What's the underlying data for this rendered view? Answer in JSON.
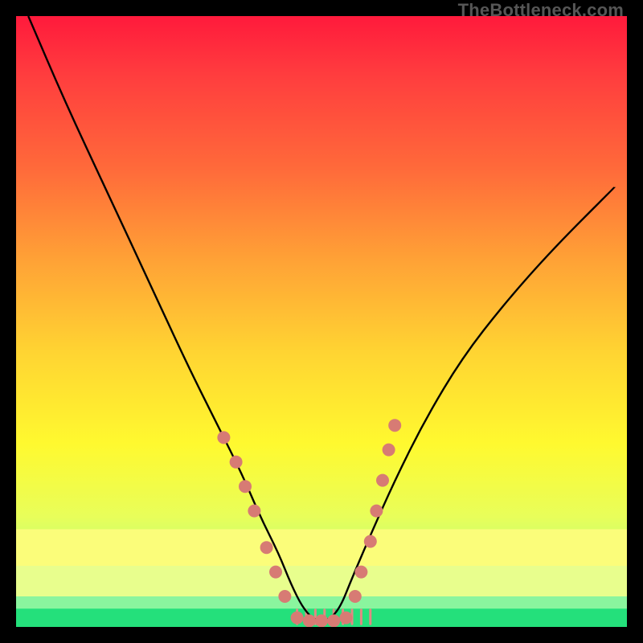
{
  "watermark": "TheBottleneck.com",
  "chart_data": {
    "type": "line",
    "title": "",
    "xlabel": "",
    "ylabel": "",
    "xlim": [
      0,
      100
    ],
    "ylim": [
      0,
      100
    ],
    "grid": false,
    "legend": false,
    "curve_note": "V-shaped curve representing bottleneck percentage; minimum at center, sharply rising to both sides. Y axis is inverted visually (high value plotted near top).",
    "series": [
      {
        "name": "bottleneck-curve",
        "x": [
          2,
          8,
          15,
          22,
          28,
          33,
          37,
          40,
          43,
          45,
          47,
          49,
          51,
          53,
          55,
          58,
          62,
          67,
          73,
          80,
          88,
          98
        ],
        "y": [
          100,
          86,
          71,
          56,
          43,
          33,
          25,
          18,
          12,
          7,
          3,
          1,
          1,
          3,
          8,
          15,
          24,
          34,
          44,
          53,
          62,
          72
        ]
      }
    ],
    "markers": {
      "name": "highlight-dots",
      "note": "salmon dots clustered on lower portions of both curve arms and along the trough",
      "points_xy": [
        [
          34,
          31
        ],
        [
          36,
          27
        ],
        [
          37.5,
          23
        ],
        [
          39,
          19
        ],
        [
          41,
          13
        ],
        [
          42.5,
          9
        ],
        [
          44,
          5
        ],
        [
          46,
          1.5
        ],
        [
          48,
          1
        ],
        [
          50,
          1
        ],
        [
          52,
          1
        ],
        [
          54,
          1.5
        ],
        [
          55.5,
          5
        ],
        [
          56.5,
          9
        ],
        [
          58,
          14
        ],
        [
          59,
          19
        ],
        [
          60,
          24
        ],
        [
          61,
          29
        ],
        [
          62,
          33
        ]
      ]
    },
    "bands": [
      {
        "name": "green-band",
        "y0": 0,
        "y1": 3,
        "color": "#24e07b"
      },
      {
        "name": "mint-band",
        "y0": 3,
        "y1": 5,
        "color": "#8af59e"
      },
      {
        "name": "pale-band",
        "y0": 5,
        "y1": 10,
        "color": "#e8fe8d"
      },
      {
        "name": "yellow-band",
        "y0": 10,
        "y1": 16,
        "color": "#fbfd7a"
      }
    ],
    "gradient_stops": [
      {
        "offset": 0.0,
        "color": "#ff1a3c"
      },
      {
        "offset": 0.1,
        "color": "#ff3e3e"
      },
      {
        "offset": 0.25,
        "color": "#ff6a3a"
      },
      {
        "offset": 0.4,
        "color": "#ffa236"
      },
      {
        "offset": 0.55,
        "color": "#ffd432"
      },
      {
        "offset": 0.7,
        "color": "#fff92f"
      },
      {
        "offset": 0.82,
        "color": "#e8fe5a"
      },
      {
        "offset": 0.9,
        "color": "#b8fd78"
      },
      {
        "offset": 0.96,
        "color": "#6cf08e"
      },
      {
        "offset": 1.0,
        "color": "#20dd7a"
      }
    ],
    "colors": {
      "curve": "#000000",
      "marker": "#d77b74",
      "marker_tick": "#e08a83"
    }
  }
}
